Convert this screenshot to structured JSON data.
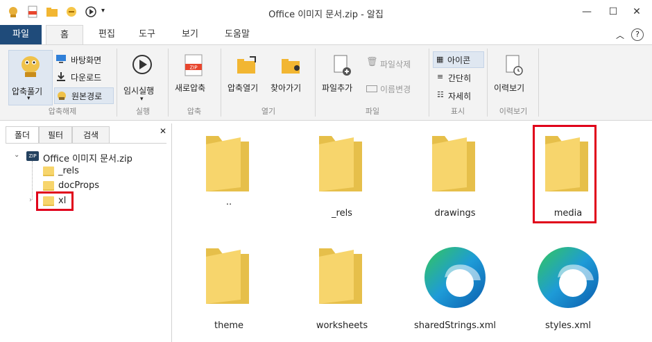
{
  "window": {
    "title": "Office 이미지 문서.zip - 알집",
    "minimize": "—",
    "maximize": "☐",
    "close": "✕"
  },
  "tabs": [
    "파일",
    "홈",
    "편집",
    "도구",
    "보기",
    "도움말"
  ],
  "ribbon_right": {
    "collapse": "︿",
    "help": "?"
  },
  "ribbon": {
    "extract": {
      "label": "압축풀기",
      "desktop": "바탕화면",
      "downloads": "다운로드",
      "original_path": "원본경로",
      "group": "압축해제"
    },
    "run": {
      "label": "임시실행",
      "group": "실행"
    },
    "compress": {
      "label": "새로압축",
      "group": "압축"
    },
    "open": {
      "open_archive": "압축열기",
      "find": "찾아가기",
      "group": "열기"
    },
    "file": {
      "add": "파일추가",
      "delete": "파일삭제",
      "rename": "이름변경",
      "group": "파일"
    },
    "view": {
      "icons": "아이콘",
      "simple": "간단히",
      "details": "자세히",
      "group": "표시"
    },
    "history": {
      "label": "이력보기",
      "group": "이력보기"
    },
    "zip_badge": "ZIP"
  },
  "left_pane": {
    "tabs": [
      "폴더",
      "필터",
      "검색"
    ],
    "close": "✕",
    "tree": {
      "root": "Office 이미지 문서.zip",
      "root_badge": "ZIP",
      "items": [
        "_rels",
        "docProps",
        "xl"
      ]
    }
  },
  "files": [
    {
      "name": "..",
      "type": "folder"
    },
    {
      "name": "_rels",
      "type": "folder"
    },
    {
      "name": "drawings",
      "type": "folder"
    },
    {
      "name": "media",
      "type": "folder"
    },
    {
      "name": "theme",
      "type": "folder"
    },
    {
      "name": "worksheets",
      "type": "folder"
    },
    {
      "name": "sharedStrings.xml",
      "type": "edge-file"
    },
    {
      "name": "styles.xml",
      "type": "edge-file"
    }
  ],
  "colors": {
    "folder": "#f7d56c",
    "folder_dark": "#e6bf4a",
    "accent": "#1f4b7a",
    "highlight": "#e0001a"
  }
}
